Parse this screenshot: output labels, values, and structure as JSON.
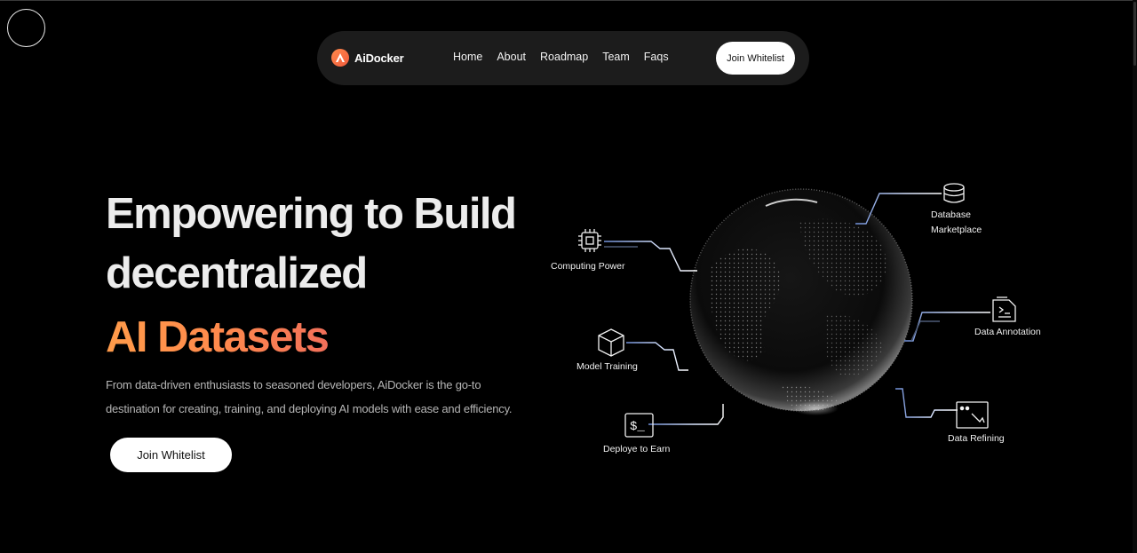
{
  "brand": {
    "name": "AiDocker",
    "accent": "#ff8a4c"
  },
  "nav": {
    "links": [
      "Home",
      "About",
      "Roadmap",
      "Team",
      "Faqs"
    ],
    "cta_label": "Join Whitelist"
  },
  "hero": {
    "title_line1": "Empowering to Build",
    "title_line2": "decentralized",
    "title_accent": "AI Datasets",
    "description": "From data-driven enthusiasts to seasoned developers, AiDocker is the go-to destination for creating, training, and deploying AI models with ease and efficiency.",
    "cta_label": "Join Whitelist"
  },
  "graphic": {
    "nodes": {
      "computing_power": "Computing Power",
      "database_marketplace_1": "Database",
      "database_marketplace_2": "Marketplace",
      "model_training": "Model Training",
      "data_annotation": "Data Annotation",
      "deploy_to_earn": "Deploye to Earn",
      "data_refining": "Data Refining"
    },
    "icons": {
      "computing_power": "cpu-icon",
      "database_marketplace": "database-icon",
      "model_training": "cube-icon",
      "data_annotation": "document-icon",
      "deploy_to_earn": "terminal-icon",
      "data_refining": "image-chart-icon"
    }
  }
}
